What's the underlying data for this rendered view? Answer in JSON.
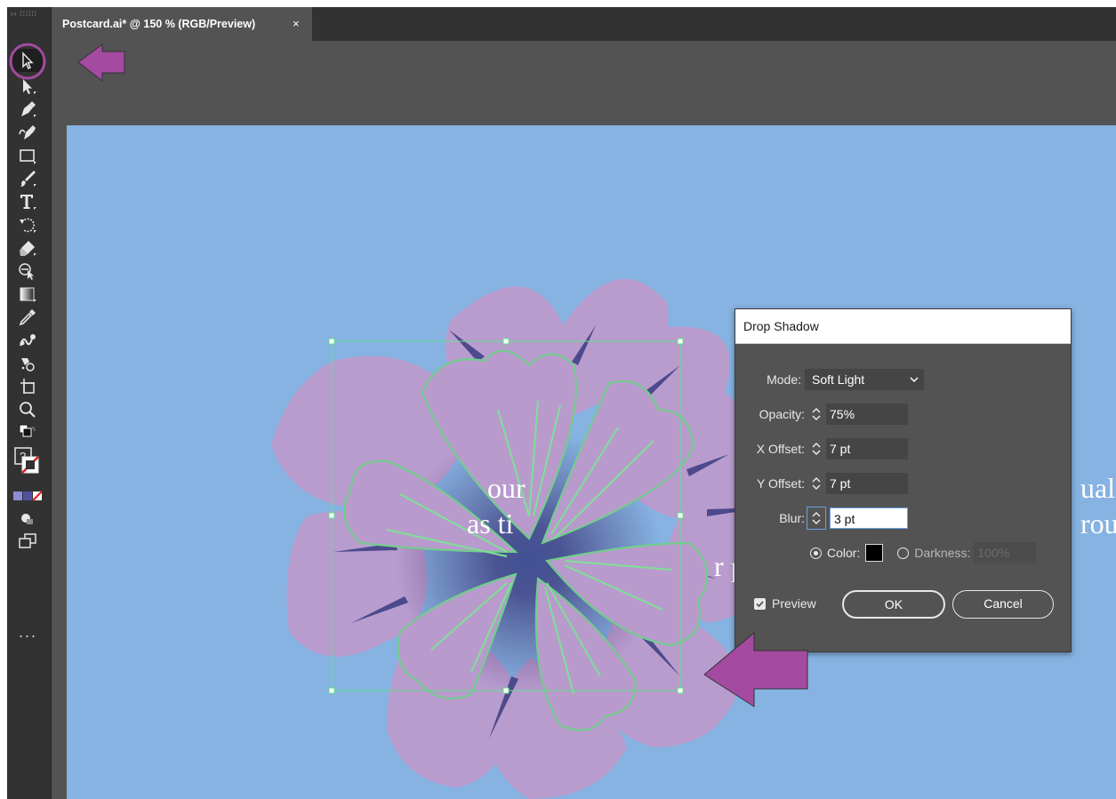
{
  "document_tab": {
    "title": "Postcard.ai* @ 150 % (RGB/Preview)",
    "close_glyph": "×"
  },
  "toolbar": {
    "grip": "›› ⁞⁞⁞⁞⁞⁞",
    "tools": [
      "selection-tool",
      "direct-selection-tool",
      "pen-tool",
      "curvature-tool",
      "rectangle-tool",
      "paintbrush-tool",
      "type-tool",
      "rotate-tool",
      "eraser-tool",
      "shape-builder-tool",
      "gradient-tool",
      "eyedropper-tool",
      "blend-tool",
      "symbol-sprayer-tool",
      "artboard-tool",
      "zoom-tool"
    ],
    "swap_label": "?",
    "more": "···"
  },
  "artboard": {
    "background": "#86b3e2",
    "text_fragments": [
      "our",
      "as ti",
      "r p",
      "uall",
      "rou"
    ]
  },
  "drop_shadow": {
    "title": "Drop Shadow",
    "mode": {
      "label": "Mode:",
      "value": "Soft Light"
    },
    "opacity": {
      "label": "Opacity:",
      "value": "75%"
    },
    "x_offset": {
      "label": "X Offset:",
      "value": "7 pt"
    },
    "y_offset": {
      "label": "Y Offset:",
      "value": "7 pt"
    },
    "blur": {
      "label": "Blur:",
      "value": "3 pt"
    },
    "color": {
      "label": "Color:",
      "selected": true,
      "swatch": "#000000"
    },
    "darkness": {
      "label": "Darkness:",
      "value": "100%",
      "selected": false
    },
    "preview": {
      "label": "Preview",
      "checked": true
    },
    "ok_label": "OK",
    "cancel_label": "Cancel"
  },
  "colors": {
    "annotation": "#a44aa1",
    "selection": "#5fe08a",
    "petal": "#b79ccd",
    "petal_shadow": "#3b2a6a"
  }
}
